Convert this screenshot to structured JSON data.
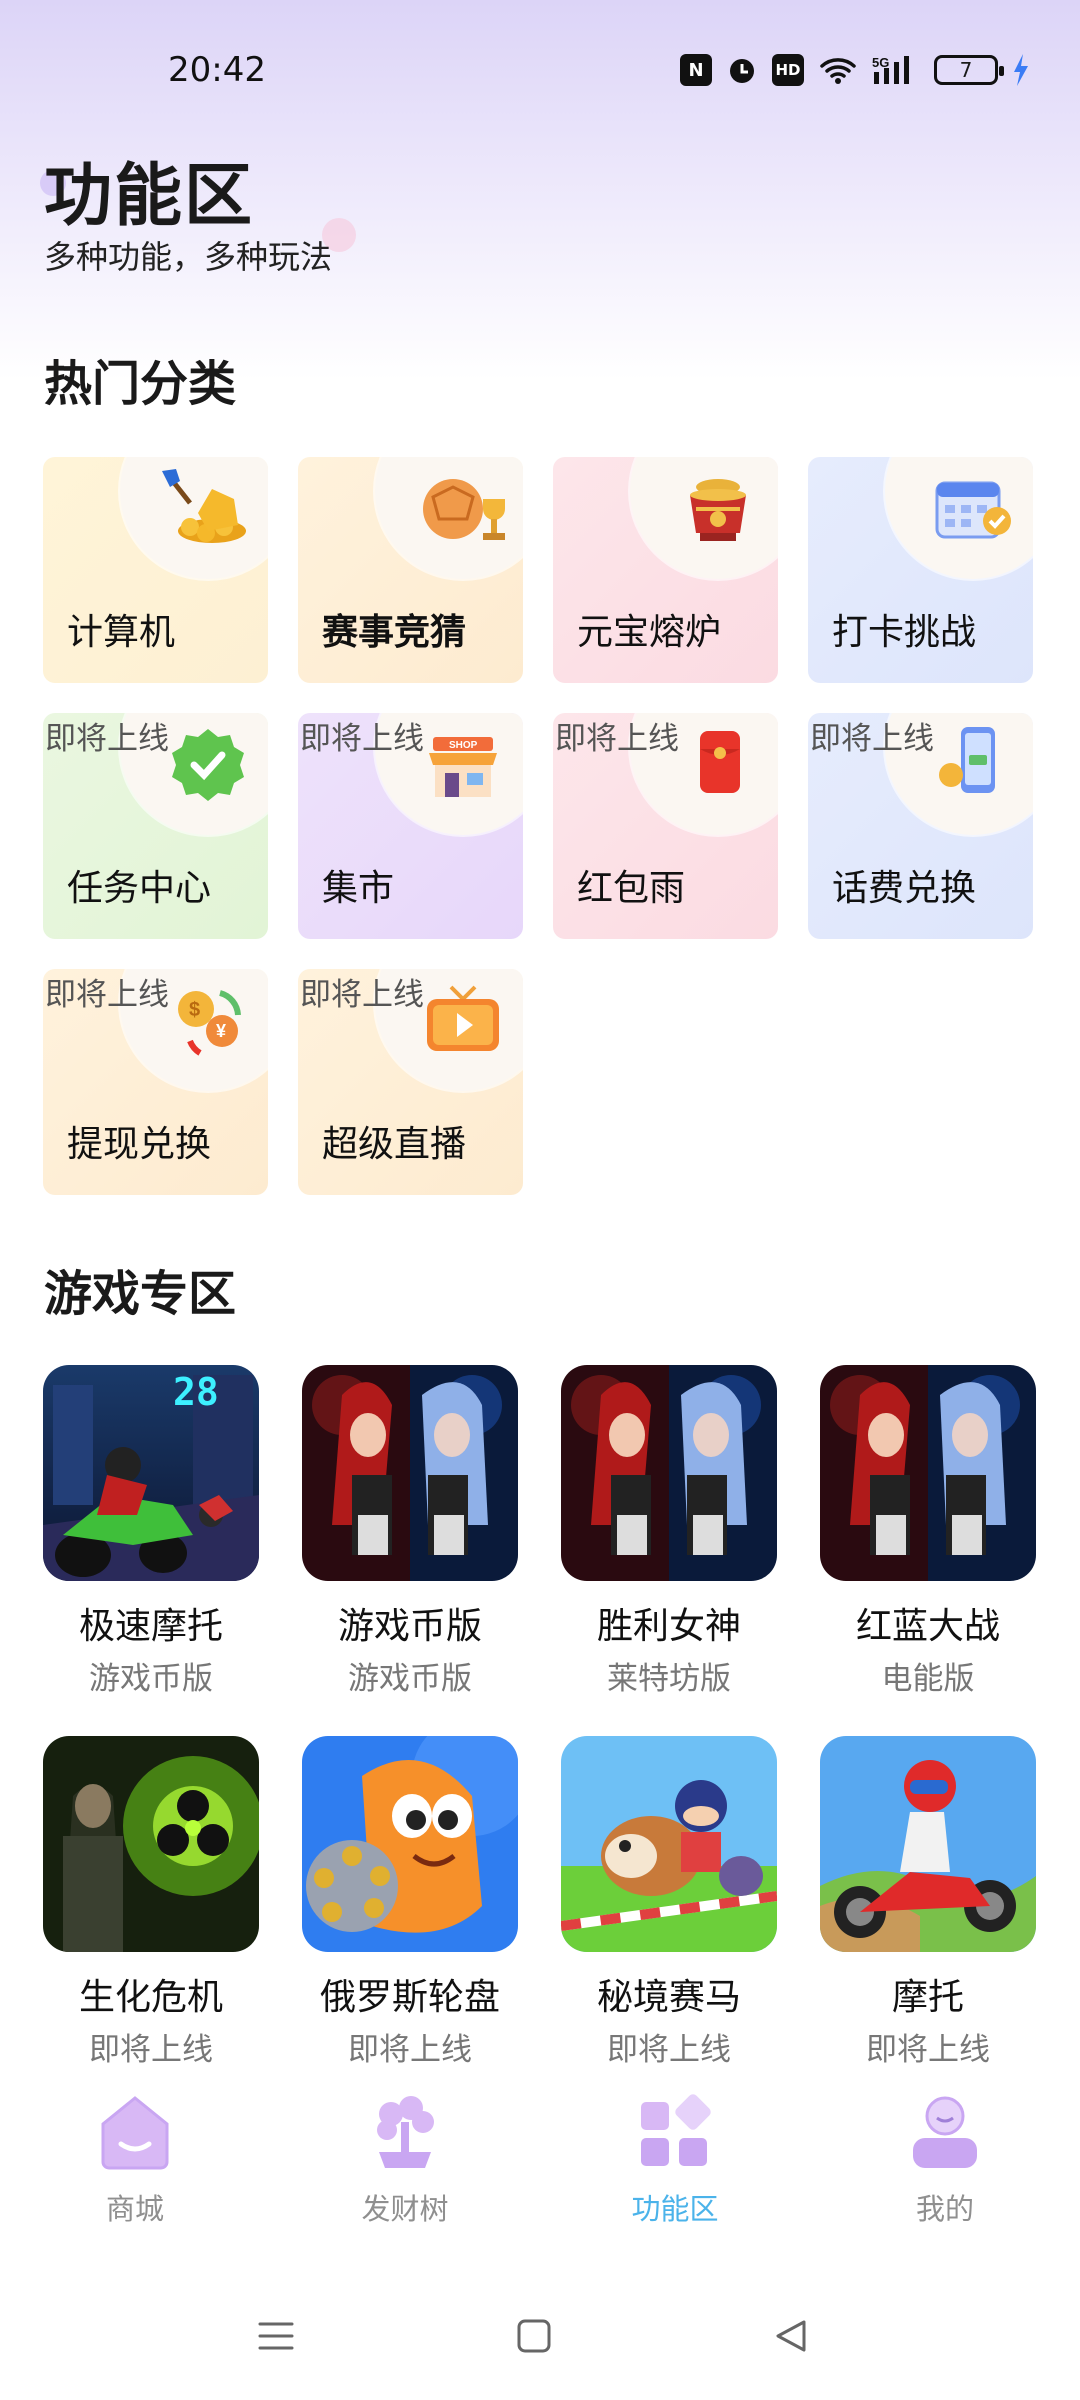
{
  "status": {
    "time": "20:42",
    "battery": "7",
    "icons": [
      "nfc-icon",
      "alarm-icon",
      "hd-icon",
      "wifi-icon",
      "signal-5g-icon",
      "battery-icon",
      "charging-icon"
    ]
  },
  "header": {
    "title": "功能区",
    "subtitle": "多种功能，多种玩法"
  },
  "hot": {
    "title": "热门分类",
    "soon_label": "即将上线",
    "items": [
      {
        "label": "计算机",
        "icon": "gold-ingots-icon",
        "tint": "yellow",
        "soon": false
      },
      {
        "label": "赛事竞猜",
        "icon": "ball-trophy-icon",
        "tint": "cream",
        "soon": false
      },
      {
        "label": "元宝熔炉",
        "icon": "treasure-pot-icon",
        "tint": "pink",
        "soon": false
      },
      {
        "label": "打卡挑战",
        "icon": "calendar-check-icon",
        "tint": "blue",
        "soon": false
      },
      {
        "label": "任务中心",
        "icon": "check-badge-icon",
        "tint": "green",
        "soon": true
      },
      {
        "label": "集市",
        "icon": "shop-icon",
        "tint": "purple",
        "soon": true
      },
      {
        "label": "红包雨",
        "icon": "red-envelope-icon",
        "tint": "pink",
        "soon": true
      },
      {
        "label": "话费兑换",
        "icon": "phone-recharge-icon",
        "tint": "blue",
        "soon": true
      },
      {
        "label": "提现兑换",
        "icon": "coin-exchange-icon",
        "tint": "cream",
        "soon": true
      },
      {
        "label": "超级直播",
        "icon": "live-tv-icon",
        "tint": "cream",
        "soon": true
      }
    ]
  },
  "games": {
    "title": "游戏专区",
    "items": [
      {
        "name": "极速摩托",
        "sub": "游戏币版",
        "art": "motor-race"
      },
      {
        "name": "游戏币版",
        "sub": "游戏币版",
        "art": "red-blue-girls"
      },
      {
        "name": "胜利女神",
        "sub": "莱特坊版",
        "art": "red-blue-girls"
      },
      {
        "name": "红蓝大战",
        "sub": "电能版",
        "art": "red-blue-girls"
      },
      {
        "name": "生化危机",
        "sub": "即将上线",
        "art": "biohazard"
      },
      {
        "name": "俄罗斯轮盘",
        "sub": "即将上线",
        "art": "revolver-snail"
      },
      {
        "name": "秘境赛马",
        "sub": "即将上线",
        "art": "horse-race"
      },
      {
        "name": "摩托",
        "sub": "即将上线",
        "art": "dirt-bike"
      }
    ]
  },
  "tabs": [
    {
      "label": "商城",
      "icon": "home-icon",
      "active": false
    },
    {
      "label": "发财树",
      "icon": "money-tree-icon",
      "active": false
    },
    {
      "label": "功能区",
      "icon": "grid-icon",
      "active": true
    },
    {
      "label": "我的",
      "icon": "profile-icon",
      "active": false
    }
  ],
  "colors": {
    "accent": "#4bb3ea",
    "tab_icon": "#c9a6f2",
    "header_bg": "#dcd4f7"
  }
}
